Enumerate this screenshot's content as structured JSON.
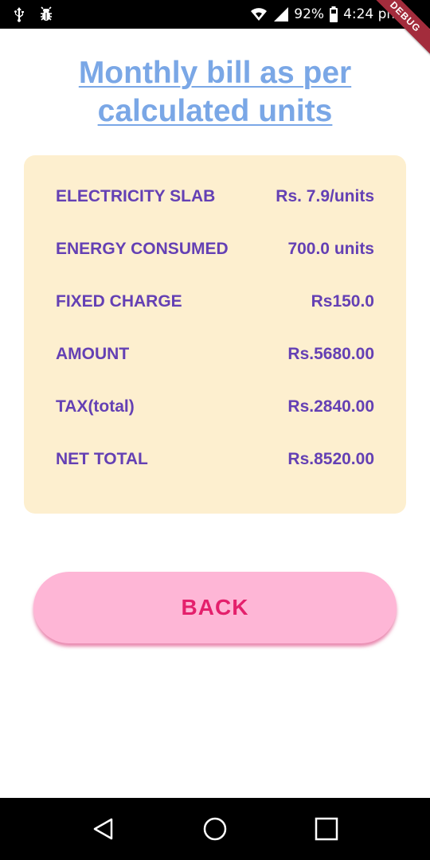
{
  "status_bar": {
    "battery_percent": "92%",
    "time": "4:24 pm"
  },
  "debug_ribbon": "DEBUG",
  "title": {
    "line1": "Monthly bill as per",
    "line2": "calculated units"
  },
  "bill": {
    "rows": [
      {
        "label": "ELECTRICITY SLAB",
        "value": "Rs. 7.9/units"
      },
      {
        "label": "ENERGY CONSUMED",
        "value": "700.0 units"
      },
      {
        "label": "FIXED CHARGE",
        "value": "Rs150.0"
      },
      {
        "label": "AMOUNT",
        "value": "Rs.5680.00"
      },
      {
        "label": "TAX(total)",
        "value": "Rs.2840.00"
      },
      {
        "label": "NET TOTAL",
        "value": "Rs.8520.00"
      }
    ]
  },
  "back_button": {
    "label": "BACK"
  },
  "colors": {
    "title": "#7aa7e6",
    "card_bg": "#fdefcf",
    "row_text": "#6440b4",
    "button_bg": "#feb6d6",
    "button_text": "#e4206c"
  }
}
